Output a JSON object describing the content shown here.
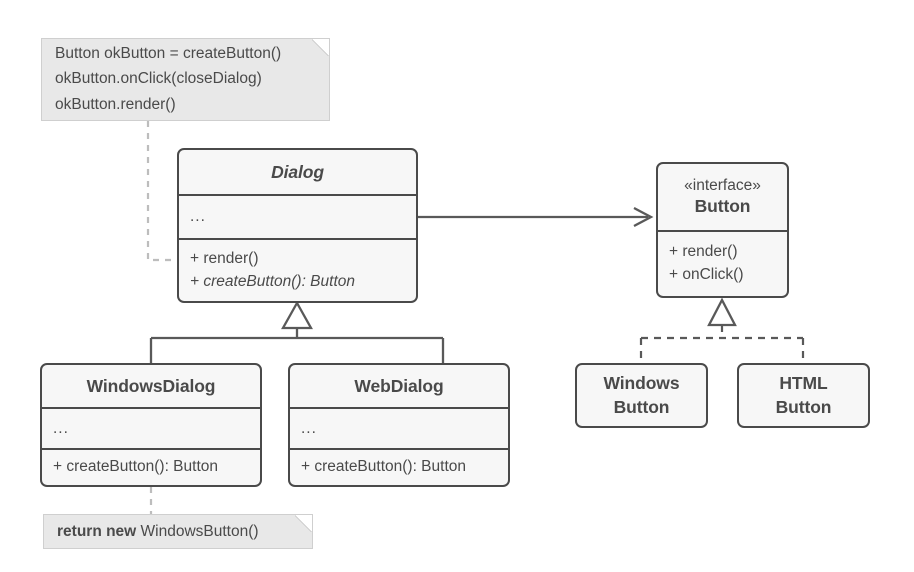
{
  "diagram": {
    "title": "Factory Method pattern UML class diagram",
    "colors": {
      "box_fill": "#f7f7f7",
      "box_border": "#4a4a4a",
      "note_fill": "#e8e8e8",
      "note_border": "#cfcfcf",
      "edge": "#595959",
      "note_edge": "#bdbdbd",
      "background": "#ffffff",
      "text": "#4a4a4a"
    }
  },
  "notes": {
    "top": {
      "lines": [
        "Button okButton = createButton()",
        "okButton.onClick(closeDialog)",
        "okButton.render()"
      ]
    },
    "bottom": {
      "bold_prefix": "return new",
      "rest": " WindowsButton()"
    }
  },
  "classes": {
    "dialog": {
      "name": "Dialog",
      "is_abstract": true,
      "attributes": "...",
      "methods": [
        {
          "text": "+ render()",
          "is_abstract": false
        },
        {
          "text": "+ createButton(): Button",
          "is_abstract": true
        }
      ]
    },
    "button": {
      "stereotype": "«interface»",
      "name": "Button",
      "methods": [
        {
          "text": "+ render()",
          "is_abstract": false
        },
        {
          "text": "+ onClick()",
          "is_abstract": false
        }
      ]
    },
    "windows_dialog": {
      "name": "WindowsDialog",
      "attributes": "...",
      "methods": [
        {
          "text": "+ createButton(): Button",
          "is_abstract": false
        }
      ]
    },
    "web_dialog": {
      "name": "WebDialog",
      "attributes": "...",
      "methods": [
        {
          "text": "+ createButton(): Button",
          "is_abstract": false
        }
      ]
    },
    "windows_button": {
      "line1": "Windows",
      "line2": "Button"
    },
    "html_button": {
      "line1": "HTML",
      "line2": "Button"
    }
  },
  "relations": [
    {
      "name": "dialog-uses-button",
      "type": "association",
      "from": "Dialog",
      "to": "Button",
      "style": "solid-open-arrow"
    },
    {
      "name": "windowsdialog-extends-dialog",
      "type": "generalization",
      "from": "WindowsDialog",
      "to": "Dialog",
      "style": "solid-hollow-triangle"
    },
    {
      "name": "webdialog-extends-dialog",
      "type": "generalization",
      "from": "WebDialog",
      "to": "Dialog",
      "style": "solid-hollow-triangle"
    },
    {
      "name": "windowsbutton-implements-button",
      "type": "realization",
      "from": "WindowsButton",
      "to": "Button",
      "style": "dashed-hollow-triangle"
    },
    {
      "name": "htmlbutton-implements-button",
      "type": "realization",
      "from": "HTMLButton",
      "to": "Button",
      "style": "dashed-hollow-triangle"
    },
    {
      "name": "top-note-anchor",
      "type": "note-link",
      "from": "top note",
      "to": "Dialog",
      "style": "dashed-gray"
    },
    {
      "name": "bottom-note-anchor",
      "type": "note-link",
      "from": "WindowsDialog",
      "to": "bottom note",
      "style": "dashed-gray"
    }
  ]
}
